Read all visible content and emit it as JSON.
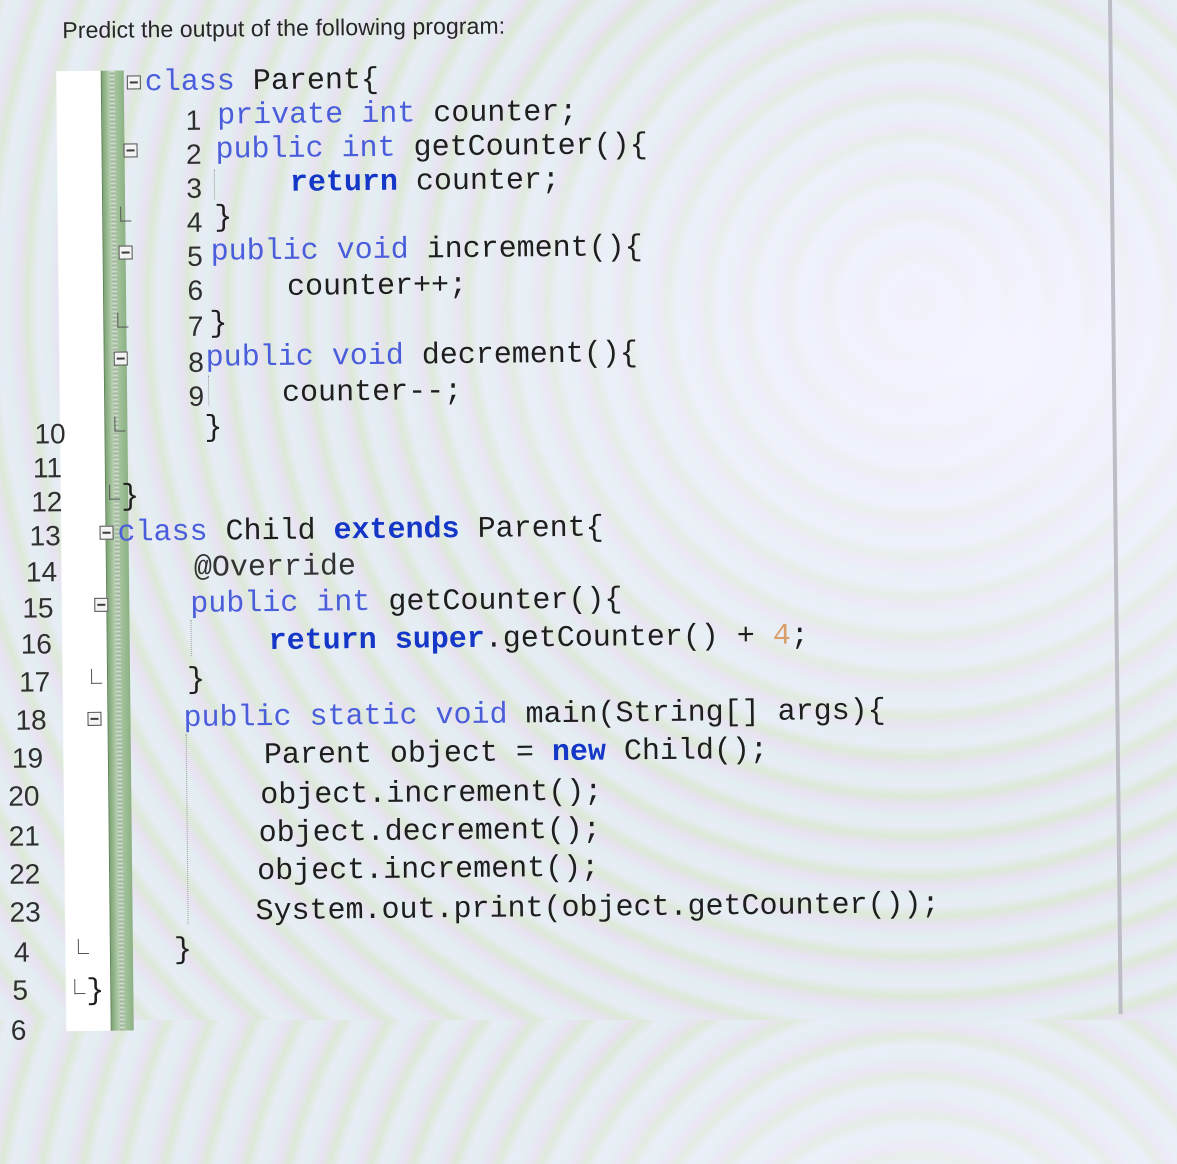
{
  "question": "Predict the output of the following program:",
  "line_numbers": [
    "1",
    "2",
    "3",
    "4",
    "5",
    "6",
    "7",
    "8",
    "9",
    "10",
    "11",
    "12",
    "13",
    "14",
    "15",
    "16",
    "17",
    "18",
    "19",
    "20",
    "21",
    "22",
    "23",
    "4",
    "5",
    "6"
  ],
  "code": {
    "l1": {
      "kw": "class",
      "rest": " Parent{"
    },
    "l2": {
      "kw1": "private",
      "kw2": "int",
      "rest": " counter;"
    },
    "l3": {
      "kw1": "public",
      "kw2": "int",
      "rest": " getCounter(){"
    },
    "l4": {
      "kw": "return",
      "rest": " counter;"
    },
    "l5": {
      "text": "}"
    },
    "l6": {
      "kw1": "public",
      "kw2": "void",
      "rest": " increment(){"
    },
    "l7": {
      "text": "counter++;"
    },
    "l8": {
      "text": "}"
    },
    "l9": {
      "kw1": "public",
      "kw2": "void",
      "rest": " decrement(){"
    },
    "l10": {
      "text": "counter--;"
    },
    "l11": {
      "text": "}"
    },
    "l13": {
      "text": "}"
    },
    "l14": {
      "kw": "class",
      "mid": " Child ",
      "kw2": "extends",
      "rest": " Parent{"
    },
    "l15": {
      "text": "@Override"
    },
    "l16": {
      "kw1": "public",
      "kw2": "int",
      "rest": " getCounter(){"
    },
    "l17": {
      "kw1": "return",
      "kw2": "super",
      "rest": ".getCounter() + ",
      "num": "4",
      "end": ";"
    },
    "l18": {
      "text": "}"
    },
    "l19": {
      "kw1": "public",
      "kw2": "static",
      "kw3": "void",
      "rest": " main(String[] args){"
    },
    "l20": {
      "pre": "Parent object = ",
      "kw": "new",
      "rest": " Child();"
    },
    "l21": {
      "text": "object.increment();"
    },
    "l22": {
      "text": "object.decrement();"
    },
    "l23": {
      "text": "object.increment();"
    },
    "l24": {
      "text": "System.out.print(object.getCounter());"
    },
    "l25": {
      "text": "}"
    },
    "l26": {
      "text": "}"
    }
  }
}
